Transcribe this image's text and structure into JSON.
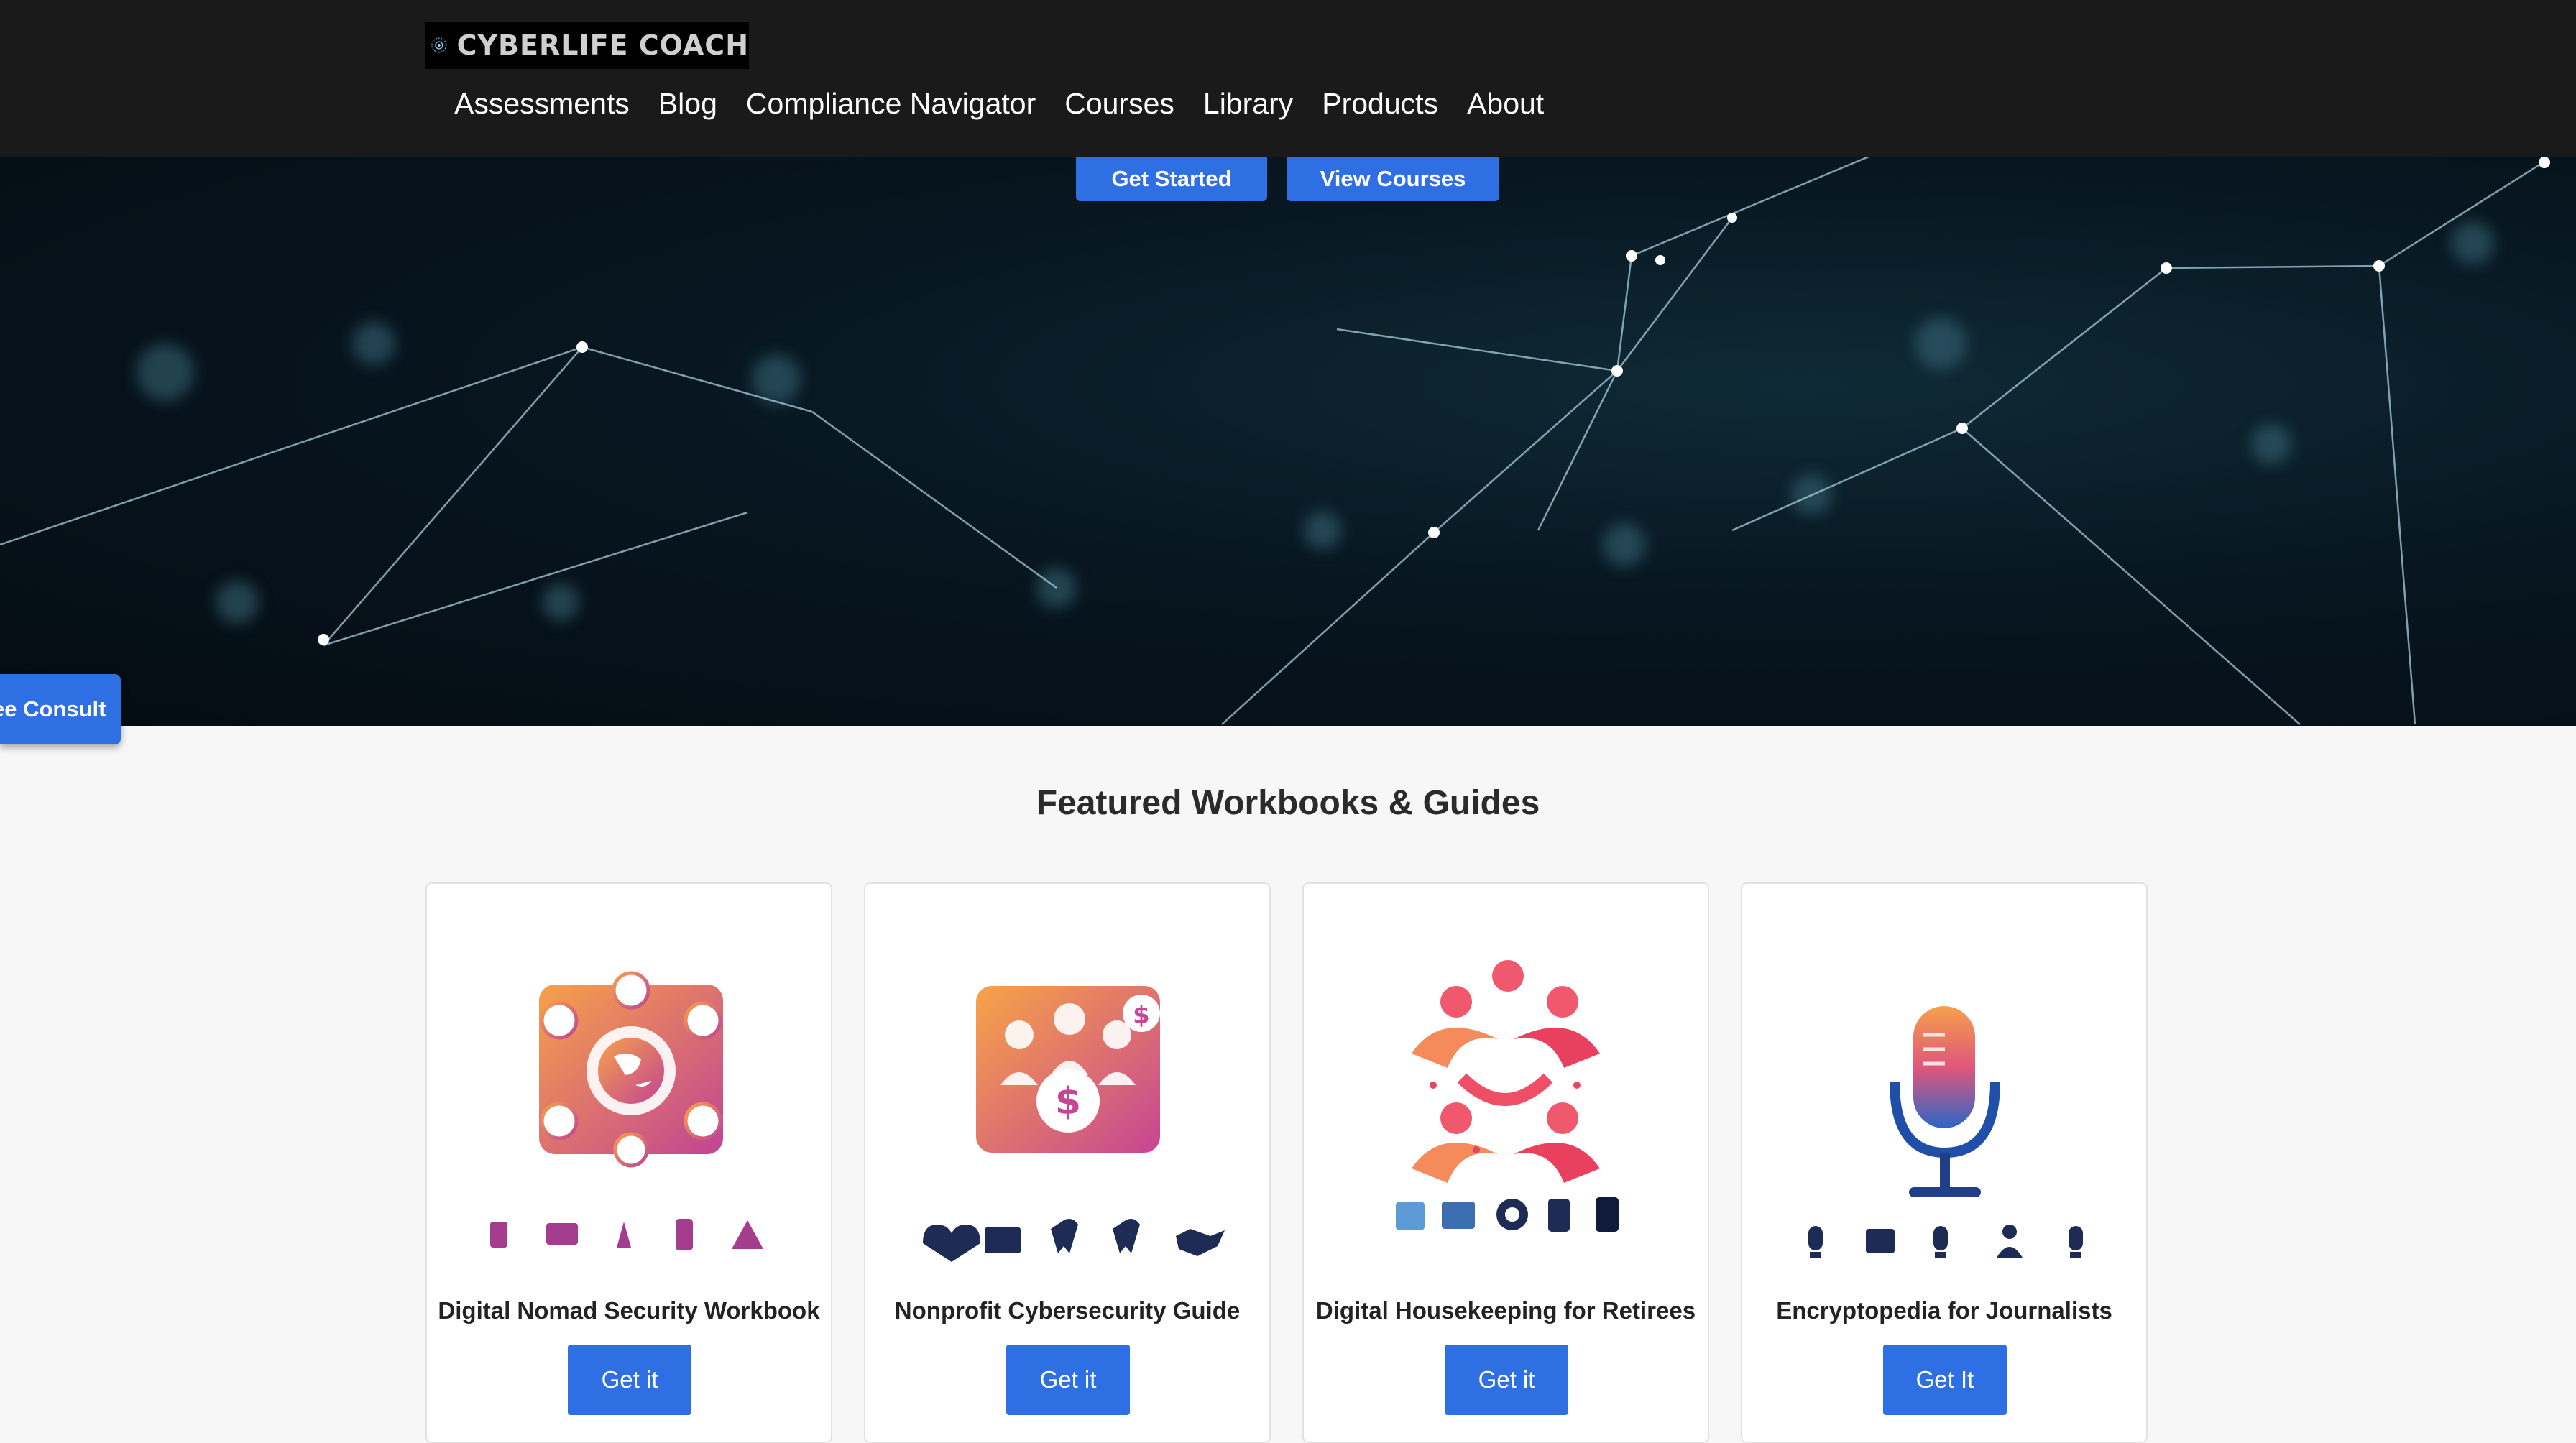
{
  "brand": {
    "name": "CYBERLIFE COACH"
  },
  "nav": [
    "Assessments",
    "Blog",
    "Compliance Navigator",
    "Courses",
    "Library",
    "Products",
    "About"
  ],
  "hero": {
    "primary_cta": "Get Started",
    "secondary_cta": "View Courses"
  },
  "consult_tab": "Free Consult",
  "featured": {
    "heading": "Featured Workbooks & Guides",
    "cards": [
      {
        "title": "Digital Nomad Security Workbook",
        "button": "Get it",
        "icon": "digital-nomad-icon"
      },
      {
        "title": "Nonprofit Cybersecurity Guide",
        "button": "Get it",
        "icon": "nonprofit-icon"
      },
      {
        "title": "Digital Housekeeping for Retirees",
        "button": "Get it",
        "icon": "retirees-icon"
      },
      {
        "title": "Encryptopedia for Journalists",
        "button": "Get It",
        "icon": "microphone-icon"
      }
    ]
  },
  "colors": {
    "accent": "#2f6fe4",
    "header": "#1a1a1a",
    "hero": "#071620"
  }
}
